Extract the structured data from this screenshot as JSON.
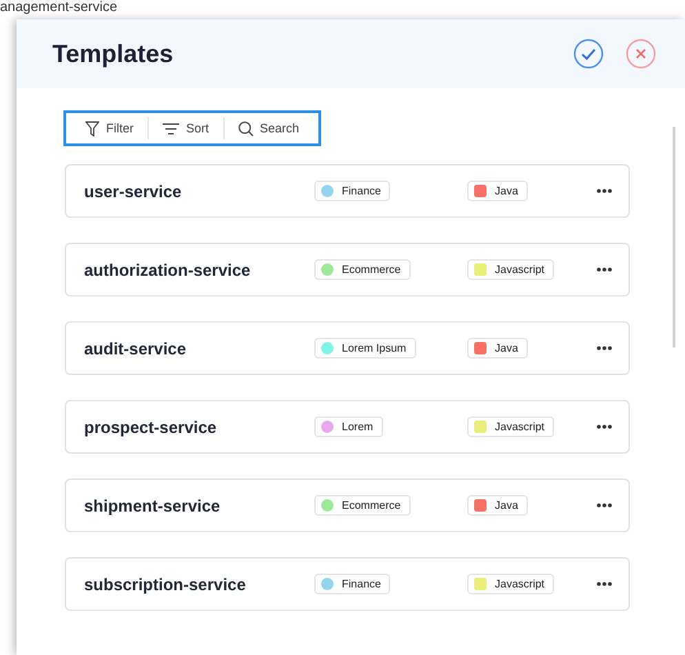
{
  "background": {
    "label": "anagement-service"
  },
  "dialog": {
    "title": "Templates",
    "toolbar": [
      {
        "kind": "filter",
        "label": "Filter"
      },
      {
        "kind": "sort",
        "label": "Sort"
      },
      {
        "kind": "search",
        "label": "Search"
      }
    ],
    "templates": [
      {
        "name": "user-service",
        "category": {
          "label": "Finance",
          "color": "#93d5ee"
        },
        "language": {
          "label": "Java",
          "color": "#f57264"
        }
      },
      {
        "name": "authorization-service",
        "category": {
          "label": "Ecommerce",
          "color": "#9ee89a"
        },
        "language": {
          "label": "Javascript",
          "color": "#eaee7a"
        }
      },
      {
        "name": "audit-service",
        "category": {
          "label": "Lorem Ipsum",
          "color": "#7ff5e8"
        },
        "language": {
          "label": "Java",
          "color": "#f57264"
        }
      },
      {
        "name": "prospect-service",
        "category": {
          "label": "Lorem",
          "color": "#e8a8f0"
        },
        "language": {
          "label": "Javascript",
          "color": "#eaee7a"
        }
      },
      {
        "name": "shipment-service",
        "category": {
          "label": "Ecommerce",
          "color": "#9ee89a"
        },
        "language": {
          "label": "Java",
          "color": "#f57264"
        }
      },
      {
        "name": "subscription-service",
        "category": {
          "label": "Finance",
          "color": "#93d5ee"
        },
        "language": {
          "label": "Javascript",
          "color": "#eaee7a"
        }
      }
    ]
  }
}
